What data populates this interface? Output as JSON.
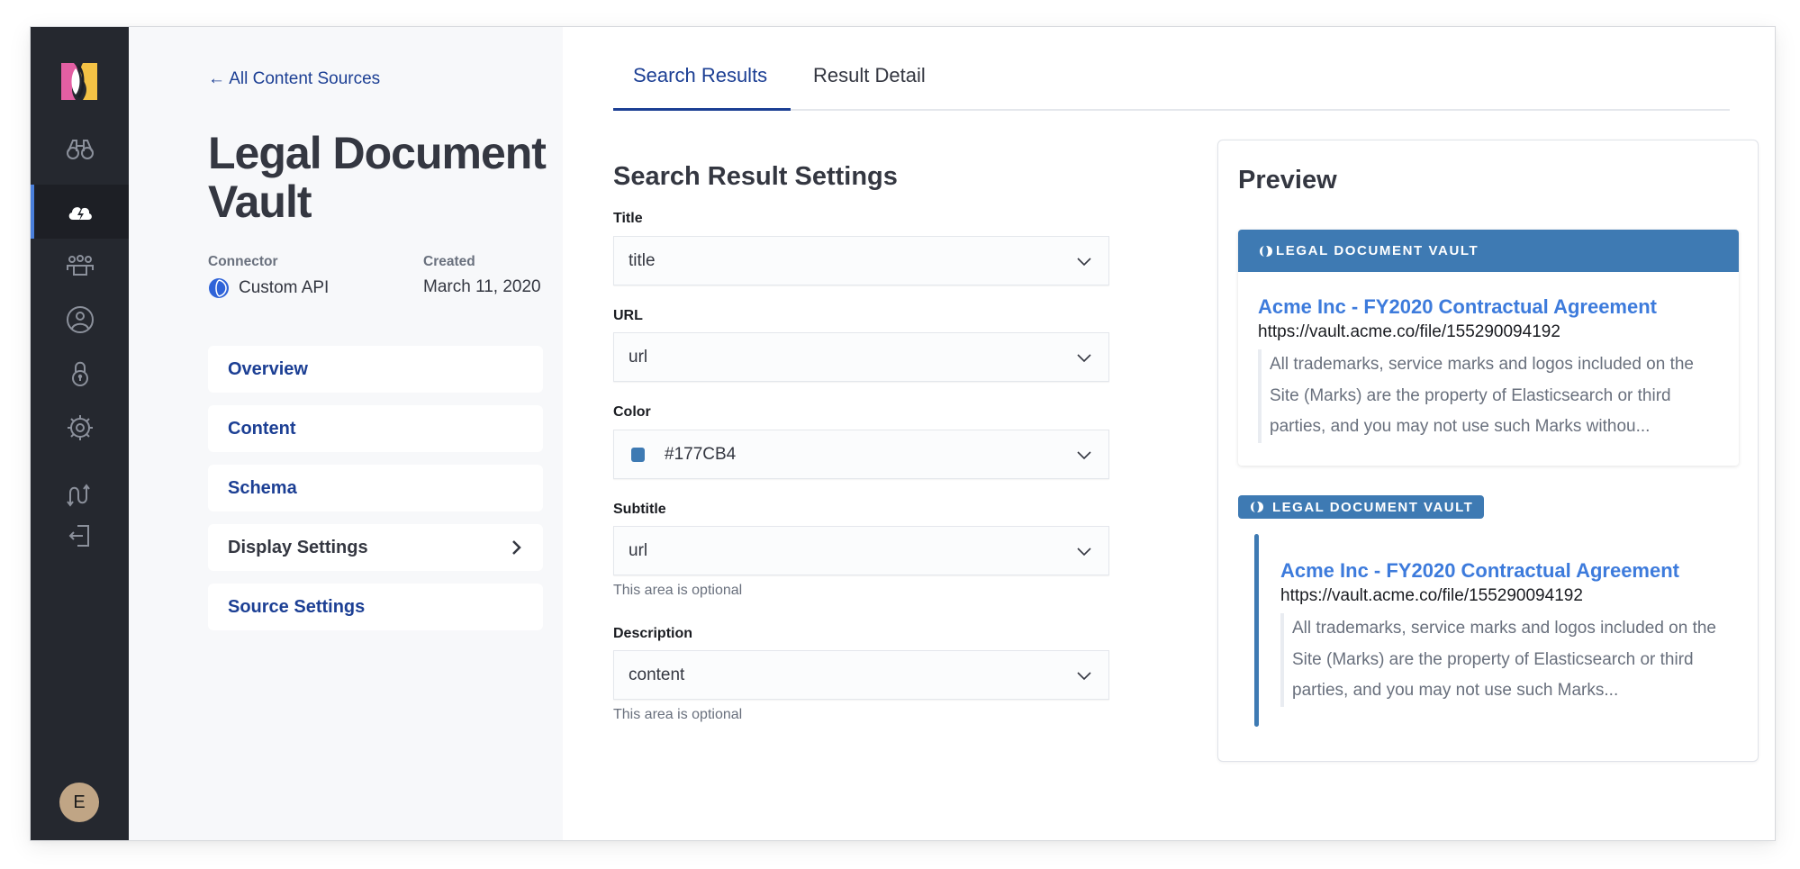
{
  "sidebar": {
    "logo": "enterprise-search-logo",
    "items": [
      {
        "name": "search",
        "icon": "binoculars-icon",
        "active": false
      },
      {
        "name": "sources",
        "icon": "cloud-lightning-icon",
        "active": true
      },
      {
        "name": "groups",
        "icon": "users-icon",
        "active": false
      },
      {
        "name": "account",
        "icon": "user-circle-icon",
        "active": false
      },
      {
        "name": "security",
        "icon": "lock-icon",
        "active": false
      },
      {
        "name": "settings",
        "icon": "gear-icon",
        "active": false
      },
      {
        "name": "switch",
        "icon": "switch-arrows-icon",
        "active": false
      },
      {
        "name": "logout",
        "icon": "logout-icon",
        "active": false
      }
    ],
    "avatar_initial": "E"
  },
  "left_panel": {
    "back_link": "All Content Sources",
    "back_icon": "←",
    "title": "Legal Document Vault",
    "connector_label": "Connector",
    "connector_value": "Custom API",
    "created_label": "Created",
    "created_value": "March 11, 2020",
    "nav": [
      {
        "label": "Overview"
      },
      {
        "label": "Content"
      },
      {
        "label": "Schema"
      },
      {
        "label": "Display Settings",
        "has_chevron": true
      },
      {
        "label": "Source Settings"
      }
    ]
  },
  "tabs": [
    {
      "label": "Search Results",
      "active": true
    },
    {
      "label": "Result Detail",
      "active": false
    }
  ],
  "settings": {
    "heading": "Search Result Settings",
    "fields": [
      {
        "label": "Title",
        "value": "title"
      },
      {
        "label": "URL",
        "value": "url"
      },
      {
        "label": "Color",
        "value": "#177CB4"
      },
      {
        "label": "Subtitle",
        "value": "url",
        "helper": "This area is optional"
      },
      {
        "label": "Description",
        "value": "content",
        "helper": "This area is optional"
      }
    ]
  },
  "preview": {
    "heading": "Preview",
    "source_name": "LEGAL DOCUMENT VAULT",
    "accent_color": "#3e7ab3",
    "result": {
      "title": "Acme Inc - FY2020 Contractual Agreement",
      "url": "https://vault.acme.co/file/155290094192",
      "description_1": "All trademarks, service marks and logos included on the Site (Marks) are the property of Elasticsearch or third parties, and you may not use such Marks withou...",
      "description_2": "All trademarks, service marks and logos included on the Site (Marks) are the property of Elasticsearch or third parties, and you may not use such Marks..."
    }
  }
}
